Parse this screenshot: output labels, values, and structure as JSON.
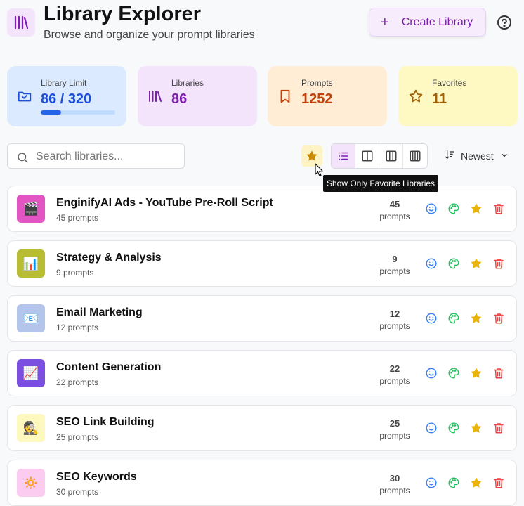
{
  "header": {
    "title": "Library Explorer",
    "subtitle": "Browse and organize your prompt libraries",
    "create_label": "Create Library",
    "plus_glyph": "+",
    "icons": {
      "app": "library-books-icon",
      "help": "help-circle-icon"
    }
  },
  "stats": [
    {
      "label": "Library Limit",
      "value": "86 / 320",
      "progress": 0.27,
      "icon": "folder-icon",
      "bg": "#dbeafe",
      "color": "#1d4ed8"
    },
    {
      "label": "Libraries",
      "value": "86",
      "icon": "library-icon",
      "bg": "#f3e3fb",
      "color": "#7c1fae"
    },
    {
      "label": "Prompts",
      "value": "1252",
      "icon": "bookmark-icon",
      "bg": "#ffedd5",
      "color": "#c2410c"
    },
    {
      "label": "Favorites",
      "value": "11",
      "icon": "star-outline-icon",
      "bg": "#fef9c3",
      "color": "#a16207"
    }
  ],
  "toolbar": {
    "search_placeholder": "Search libraries...",
    "sort_label": "Newest",
    "tooltip": "Show Only Favorite Libraries",
    "views": [
      "list-view",
      "two-column-view",
      "three-column-view",
      "four-column-view"
    ],
    "active_view": "list-view"
  },
  "libraries": [
    {
      "name": "EnginifyAI Ads - YouTube Pre-Roll Script",
      "sub": "45 prompts",
      "count": "45",
      "count_label": "prompts",
      "emoji": "🎬",
      "thumb_bg": "#e455c4",
      "favorite": true
    },
    {
      "name": "Strategy & Analysis",
      "sub": "9 prompts",
      "count": "9",
      "count_label": "prompts",
      "emoji": "📊",
      "thumb_bg": "#b8bd34",
      "favorite": true
    },
    {
      "name": "Email Marketing",
      "sub": "12 prompts",
      "count": "12",
      "count_label": "prompts",
      "emoji": "📧",
      "thumb_bg": "#b4c5ec",
      "favorite": true
    },
    {
      "name": "Content Generation",
      "sub": "22 prompts",
      "count": "22",
      "count_label": "prompts",
      "emoji": "📈",
      "thumb_bg": "#7b4fdf",
      "favorite": true
    },
    {
      "name": "SEO Link Building",
      "sub": "25 prompts",
      "count": "25",
      "count_label": "prompts",
      "emoji": "🕵️",
      "thumb_bg": "#fdf8bd",
      "favorite": true
    },
    {
      "name": "SEO Keywords",
      "sub": "30 prompts",
      "count": "30",
      "count_label": "prompts",
      "emoji": "🔅",
      "thumb_bg": "#fccbf0",
      "favorite": true
    }
  ],
  "colors": {
    "accent": "#7c1fae",
    "smiley": "#3b82f6",
    "palette": "#22c55e",
    "star": "#eab308",
    "trash": "#ef4444"
  }
}
